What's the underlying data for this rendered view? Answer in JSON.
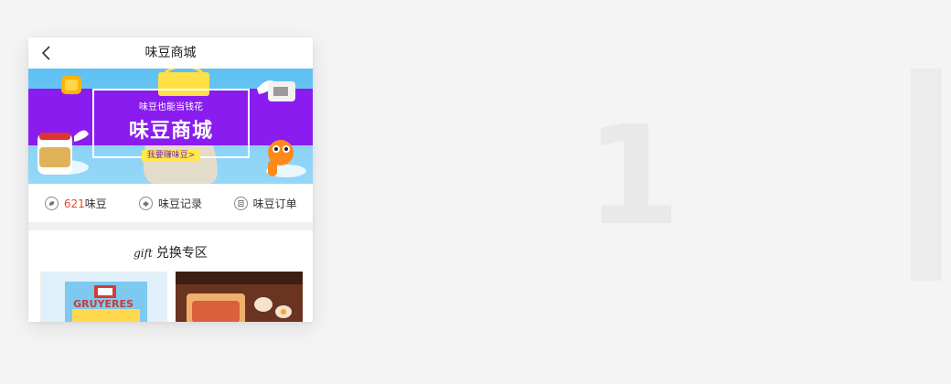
{
  "background": {
    "glyph": "1"
  },
  "header": {
    "title": "味豆商城",
    "back_icon": "chevron-left-icon"
  },
  "banner": {
    "subtitle": "味豆也能当钱花",
    "title": "味豆商城",
    "cta": "我要赚味豆>",
    "colors": {
      "sky": "#6fcaf5",
      "stripe": "#8a1cf0",
      "cta_bg": "#ffe94a"
    }
  },
  "actions": [
    {
      "count": "621",
      "label": "味豆",
      "icon": "coin-icon"
    },
    {
      "label": "味豆记录",
      "icon": "record-icon"
    },
    {
      "label": "味豆订单",
      "icon": "order-icon"
    }
  ],
  "gift": {
    "title_en": "gift",
    "title": "兑换专区",
    "products": [
      {
        "name": "gruyeres-cheese-product",
        "label": "GRUYERES"
      },
      {
        "name": "snack-product"
      }
    ]
  },
  "colors": {
    "accent": "#e8492f",
    "page_bg": "#f4f4f4"
  }
}
